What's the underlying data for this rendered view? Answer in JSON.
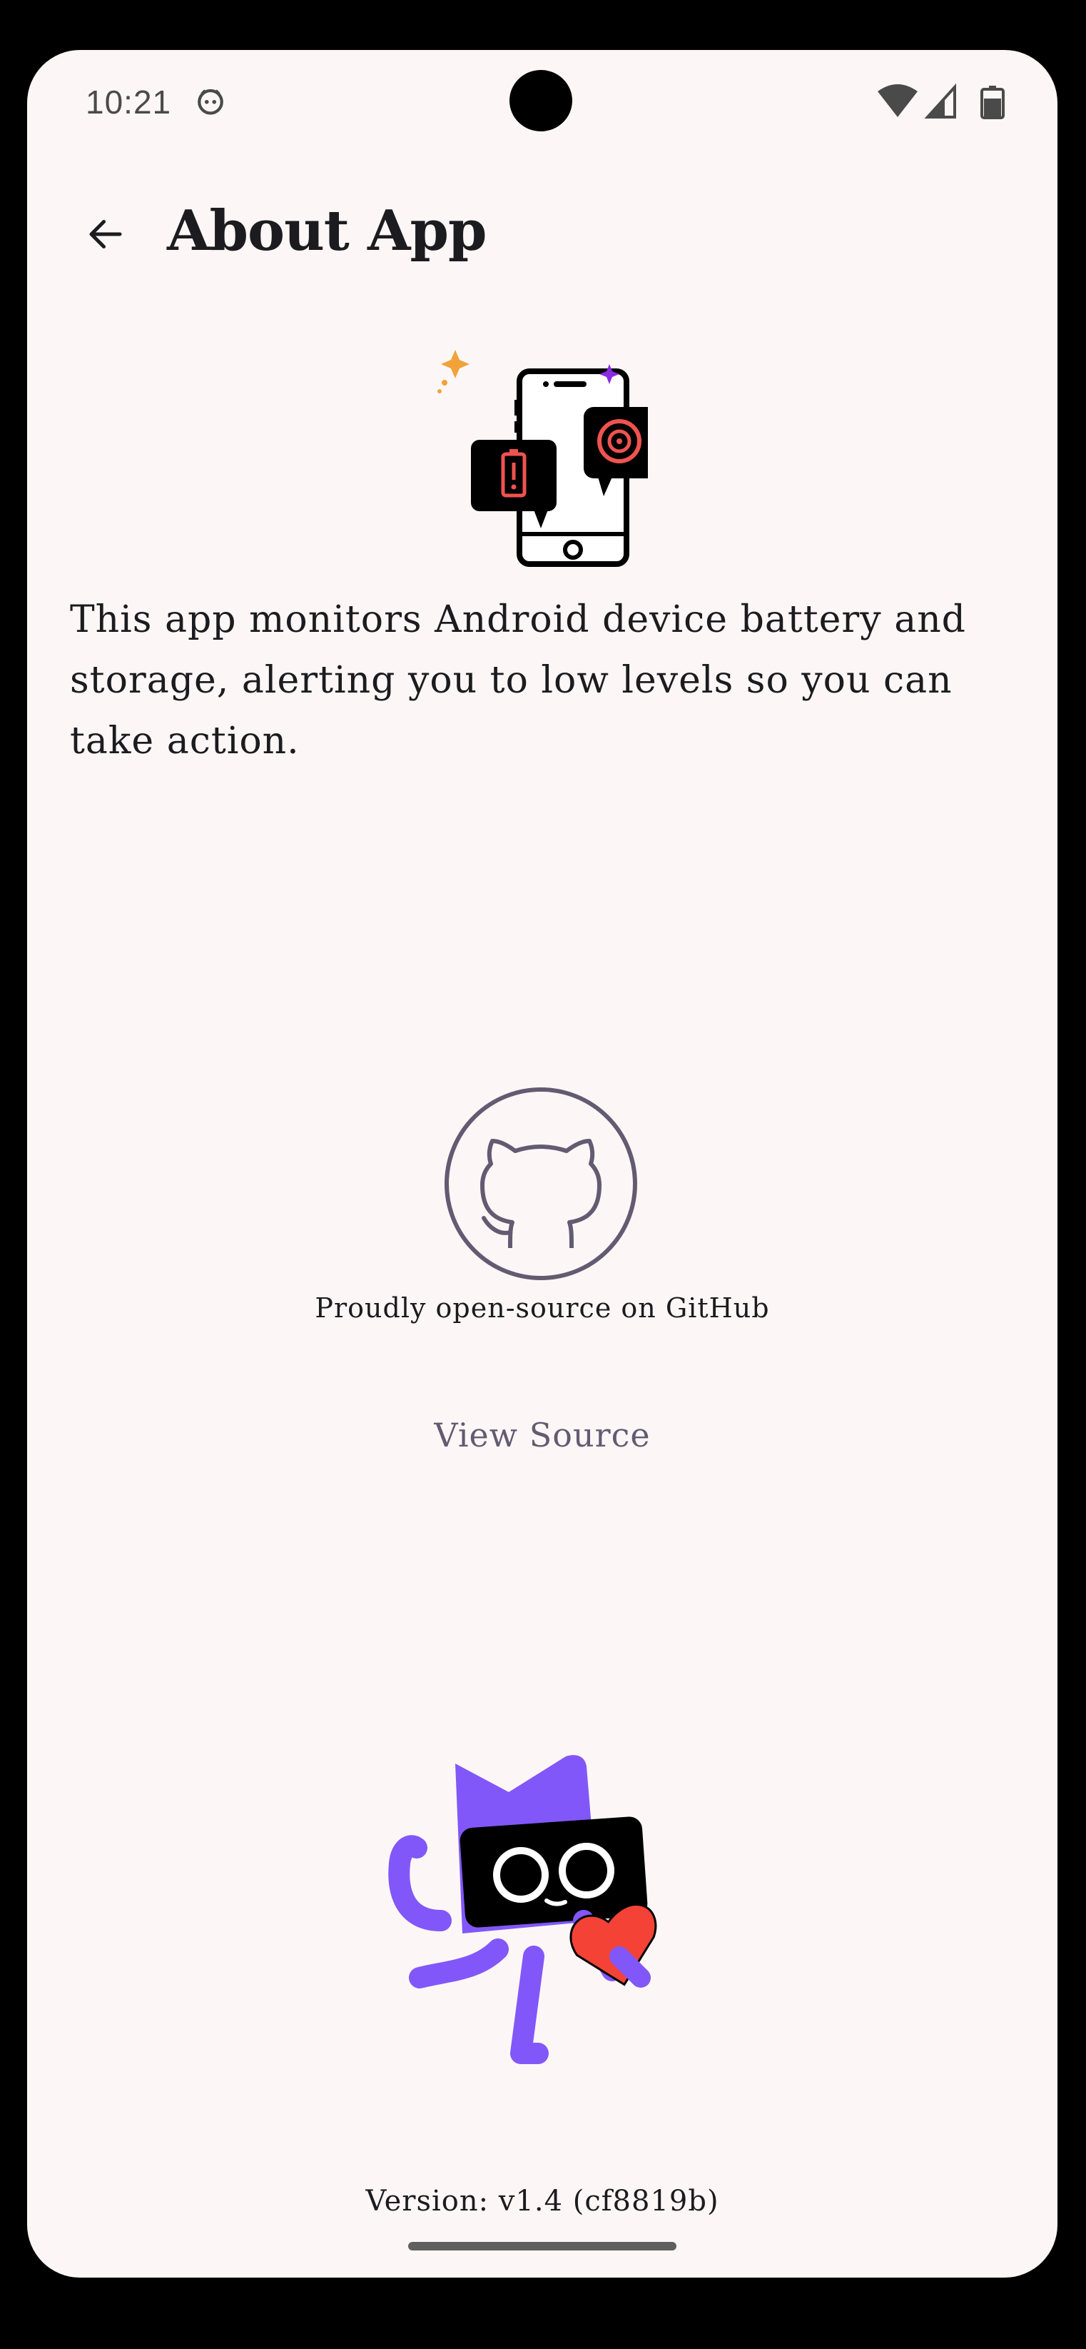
{
  "status_bar": {
    "time": "10:21",
    "notification_icon": "cat-face-icon",
    "icons": [
      "wifi-icon",
      "signal-icon",
      "battery-icon"
    ]
  },
  "app_bar": {
    "back_icon": "arrow-back-icon",
    "title": "About App"
  },
  "hero": {
    "icon": "phone-battery-storage-alert-illustration",
    "accent": "#f0534f"
  },
  "description": "This app monitors Android device battery and storage, alerting you to low levels so you can take action.",
  "github": {
    "icon": "github-icon",
    "caption": "Proudly open-source on GitHub",
    "button_label": "View Source"
  },
  "mascot": {
    "icon": "purple-cat-mascot-with-heart",
    "color": "#8257f9",
    "heart_color": "#f44336"
  },
  "version": "Version: v1.4 (cf8819b)"
}
